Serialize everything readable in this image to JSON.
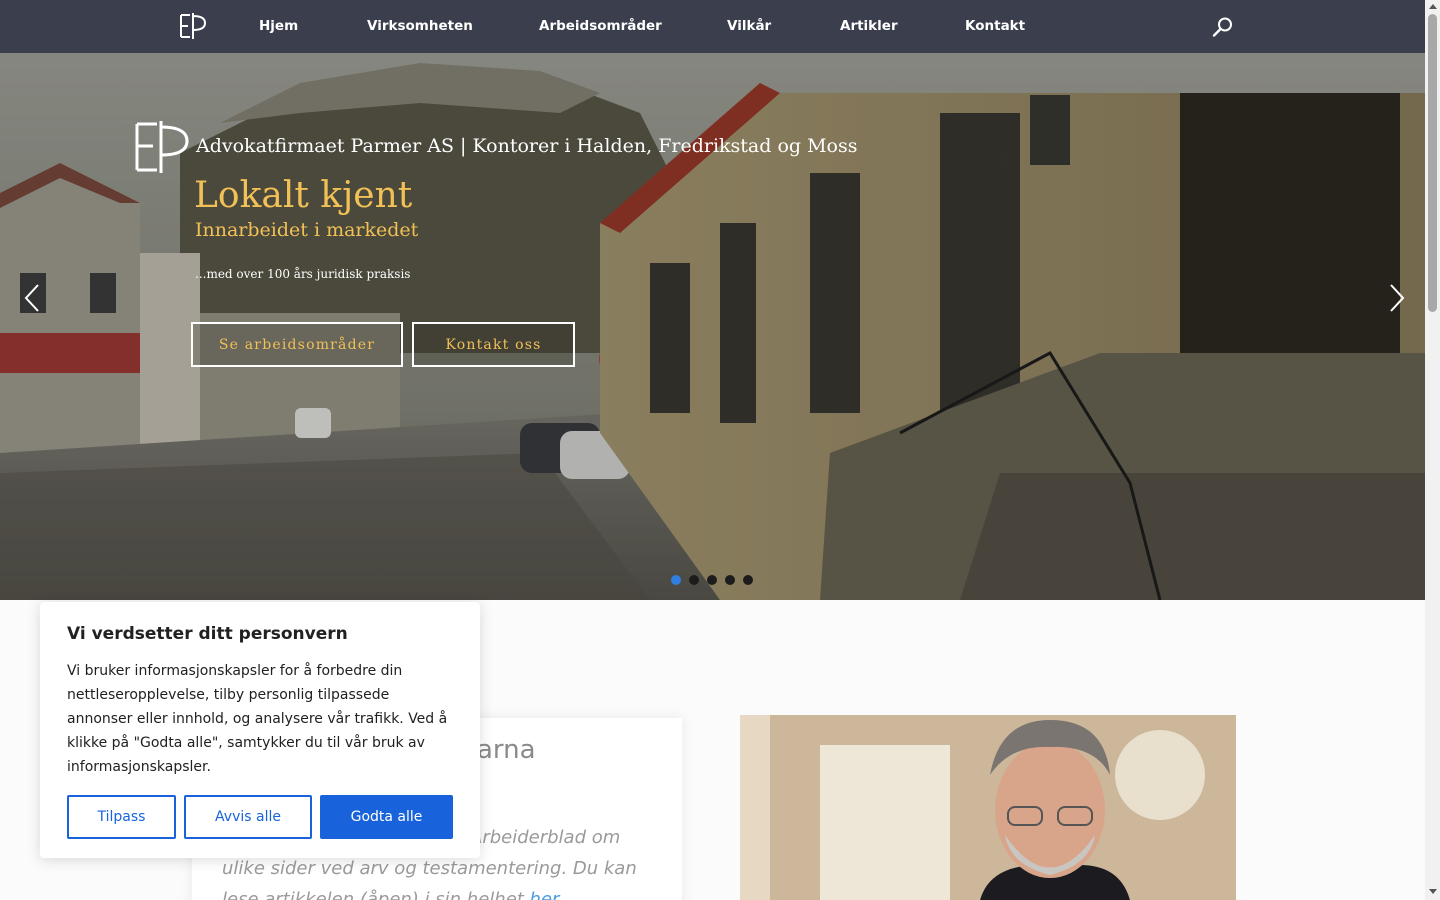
{
  "nav": {
    "items": [
      "Hjem",
      "Virksomheten",
      "Arbeidsområder",
      "Vilkår",
      "Artikler",
      "Kontakt"
    ],
    "search_icon": "search-icon"
  },
  "hero": {
    "tagline": "Advokatfirmaet Parmer AS | Kontorer i Halden, Fredrikstad og Moss",
    "title": "Lokalt kjent",
    "subtitle": "Innarbeidet i markedet",
    "small_text": "...med over 100 års juridisk praksis",
    "button_areas": "Se arbeidsområder",
    "button_contact": "Kontakt oss",
    "slide_count": 5,
    "active_slide": 1,
    "accent_color": "#f1c056"
  },
  "article": {
    "title_fragment": "arna",
    "text_line1": "Arbeiderblad om",
    "text_line2": "ulike sider ved arv og testamentering. Du kan",
    "text_line3_prefix": "lese artikkelen (åpen) i sin helhet ",
    "text_link": "her"
  },
  "cookie": {
    "title": "Vi verdsetter ditt personvern",
    "text": "Vi bruker informasjonskapsler for å forbedre din nettleseropplevelse, tilby personlig tilpassede annonser eller innhold, og analysere vår trafikk. Ved å klikke på \"Godta alle\", samtykker du til vår bruk av informasjonskapsler.",
    "customize": "Tilpass",
    "reject": "Avvis alle",
    "accept": "Godta alle",
    "accent_color": "#1863dc"
  }
}
